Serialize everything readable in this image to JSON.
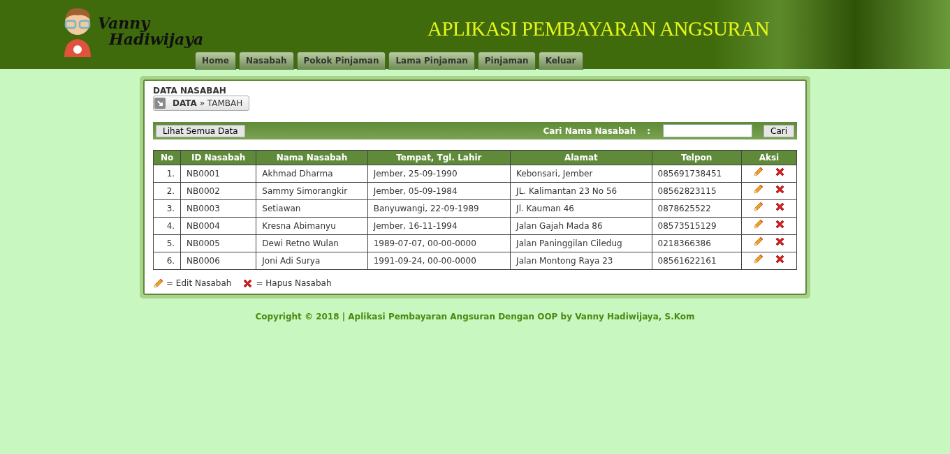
{
  "header": {
    "logo_text_1": "Vanny",
    "logo_text_2": "Hadiwijaya",
    "title": "APLIKASI PEMBAYARAN ANGSURAN"
  },
  "nav": [
    {
      "label": "Home"
    },
    {
      "label": "Nasabah"
    },
    {
      "label": "Pokok Pinjaman"
    },
    {
      "label": "Lama Pinjaman"
    },
    {
      "label": "Pinjaman"
    },
    {
      "label": "Keluar"
    }
  ],
  "page_title": "DATA NASABAH",
  "breadcrumb": "**DATA** » TAMBAH",
  "toolbar": {
    "show_all_button": "Lihat Semua Data",
    "search_label": "Cari Nama Nasabah",
    "search_colon": ":",
    "search_button": "Cari"
  },
  "table": {
    "columns": [
      "No",
      "ID Nasabah",
      "Nama Nasabah",
      "Tempat, Tgl. Lahir",
      "Alamat",
      "Telpon",
      "Aksi"
    ],
    "rows": [
      {
        "no": "1.",
        "id": "NB0001",
        "nama": "Akhmad Dharma",
        "ttl": "Jember, 25-09-1990",
        "alamat": "Kebonsari, Jember",
        "telpon": "085691738451"
      },
      {
        "no": "2.",
        "id": "NB0002",
        "nama": "Sammy Simorangkir",
        "ttl": "Jember, 05-09-1984",
        "alamat": "JL. Kalimantan 23 No 56",
        "telpon": "08562823115"
      },
      {
        "no": "3.",
        "id": "NB0003",
        "nama": "Setiawan",
        "ttl": "Banyuwangi, 22-09-1989",
        "alamat": "Jl. Kauman 46",
        "telpon": "0878625522"
      },
      {
        "no": "4.",
        "id": "NB0004",
        "nama": "Kresna Abimanyu",
        "ttl": "Jember, 16-11-1994",
        "alamat": "Jalan Gajah Mada 86",
        "telpon": "08573515129"
      },
      {
        "no": "5.",
        "id": "NB0005",
        "nama": "Dewi Retno Wulan",
        "ttl": "1989-07-07, 00-00-0000",
        "alamat": "Jalan Paninggilan Ciledug",
        "telpon": "0218366386"
      },
      {
        "no": "6.",
        "id": "NB0006",
        "nama": "Joni Adi Surya",
        "ttl": "1991-09-24, 00-00-0000",
        "alamat": "Jalan Montong Raya 23",
        "telpon": "08561622161"
      }
    ]
  },
  "legend": {
    "edit": "= Edit Nasabah",
    "delete": "= Hapus Nasabah"
  },
  "footer": "Copyright © 2018 | Aplikasi Pembayaran Angsuran Dengan OOP by Vanny Hadiwijaya, S.Kom"
}
